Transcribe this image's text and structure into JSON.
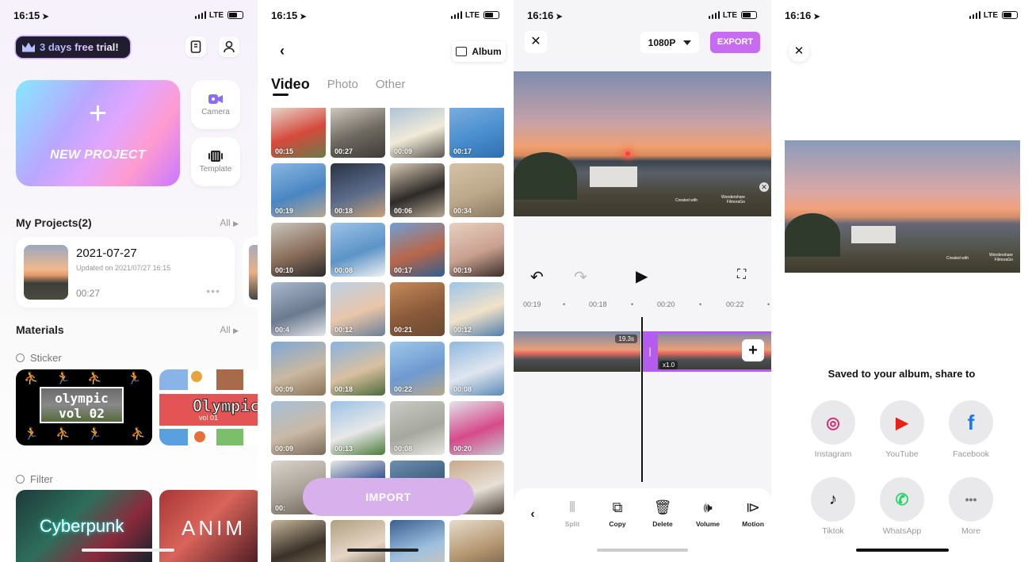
{
  "status_bars": [
    {
      "time": "16:15",
      "network": "LTE"
    },
    {
      "time": "16:15",
      "network": "LTE"
    },
    {
      "time": "16:16",
      "network": "LTE"
    },
    {
      "time": "16:16",
      "network": "LTE"
    }
  ],
  "home": {
    "trial_label": "3 days free trial!",
    "new_project_plus": "+",
    "new_project_label": "NEW PROJECT",
    "camera_label": "Camera",
    "template_label": "Template",
    "my_projects_title": "My Projects(2)",
    "all_label": "All",
    "project": {
      "date": "2021-07-27",
      "updated": "Updated on 2021/07/27 16:15",
      "duration": "00:27"
    },
    "materials_title": "Materials",
    "sticker_label": "Sticker",
    "sticker1_line1": "olympic",
    "sticker1_line2": "vol 02",
    "sticker2_text": "Olympic",
    "sticker2_sub": "vol 01",
    "filter_label": "Filter",
    "filter1_text": "Cyberpunk",
    "filter2_text": "ANIM"
  },
  "picker": {
    "album_label": "Album",
    "tabs": [
      "Video",
      "Photo",
      "Other"
    ],
    "active_tab": "Video",
    "durations": [
      "00:15",
      "00:27",
      "00:09",
      "00:17",
      "00:19",
      "00:18",
      "00:06",
      "00:34",
      "00:10",
      "00:08",
      "00:17",
      "00:19",
      "00:4",
      "00:12",
      "00:21",
      "00:12",
      "00:09",
      "00:18",
      "00:22",
      "00:08",
      "00:09",
      "00:13",
      "00:08",
      "00:20",
      "00:",
      "",
      "",
      "",
      "",
      "",
      "",
      ""
    ],
    "import_label": "IMPORT"
  },
  "editor": {
    "resolution": "1080P",
    "export_label": "EXPORT",
    "watermark_line1": "Created with",
    "watermark_line2": "Wondershare",
    "watermark_line3": "FilmoraGo",
    "ruler": [
      "00:19",
      "00:18",
      "00:20",
      "00:22"
    ],
    "clip1_badge": "19.3s",
    "clip2_speed": "x1.0",
    "tools": [
      {
        "label": "Split",
        "icon": "split-icon",
        "enabled": false
      },
      {
        "label": "Copy",
        "icon": "copy-icon",
        "enabled": true
      },
      {
        "label": "Delete",
        "icon": "delete-icon",
        "enabled": true
      },
      {
        "label": "Volume",
        "icon": "volume-icon",
        "enabled": true
      },
      {
        "label": "Motion",
        "icon": "motion-icon",
        "enabled": true
      }
    ]
  },
  "share": {
    "title": "Saved to your album, share to",
    "targets": [
      {
        "label": "Instagram",
        "icon": "instagram-icon",
        "color": "#d62976"
      },
      {
        "label": "YouTube",
        "icon": "youtube-icon",
        "color": "#e62117"
      },
      {
        "label": "Facebook",
        "icon": "facebook-icon",
        "color": "#1877f2"
      },
      {
        "label": "Tiktok",
        "icon": "tiktok-icon",
        "color": "#111111"
      },
      {
        "label": "WhatsApp",
        "icon": "whatsapp-icon",
        "color": "#25d366"
      },
      {
        "label": "More",
        "icon": "more-icon",
        "color": "#777777"
      }
    ]
  },
  "colors": {
    "accent_purple": "#c76cf0",
    "import_button": "#d8b0ec",
    "timeline_selection": "#b55cf0"
  }
}
